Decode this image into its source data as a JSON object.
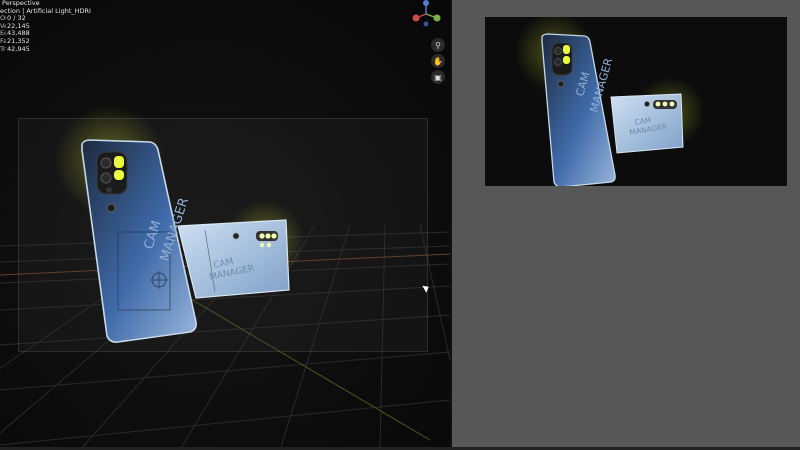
{
  "viewport": {
    "view_name": "Perspective",
    "collection_label": "ection | Artificial Light_HDRI",
    "stats": [
      {
        "label": "Objects",
        "value": "0 / 32"
      },
      {
        "label": "Vertices",
        "value": "22,145"
      },
      {
        "label": "Edges",
        "value": "43,488"
      },
      {
        "label": "Faces",
        "value": "21,352"
      },
      {
        "label": "Triangles",
        "value": "42,945"
      }
    ],
    "nav_buttons": [
      {
        "name": "zoom-icon",
        "glyph": "⚲"
      },
      {
        "name": "hand-pan-icon",
        "glyph": "✋"
      },
      {
        "name": "camera-view-icon",
        "glyph": "▣"
      }
    ]
  },
  "phone": {
    "brand_line1": "CAM",
    "brand_line2": "MANAGER"
  },
  "colors": {
    "accent_glow": "#e8ff3a",
    "phone_body": "#3f6aa8",
    "phone_light": "#b9cde6",
    "panel_bg": "#575757"
  }
}
